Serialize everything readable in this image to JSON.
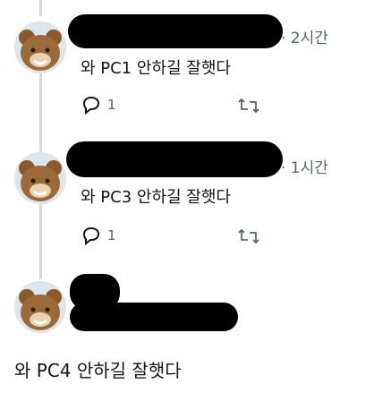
{
  "tweets": [
    {
      "time": "· 2시간",
      "text": "와 PC1 안하길 잘햇다",
      "reply_count": "1"
    },
    {
      "time": "· 1시간",
      "text": "와 PC3 안하길 잘햇다",
      "reply_count": "1"
    },
    {
      "text": "와 PC4 안하길 잘햇다"
    }
  ],
  "icons": {
    "reply": "reply-icon",
    "retweet": "retweet-icon"
  },
  "colors": {
    "text": "#0f1419",
    "muted": "#536471",
    "thread_line": "#cfd9de",
    "redaction": "#000000"
  }
}
